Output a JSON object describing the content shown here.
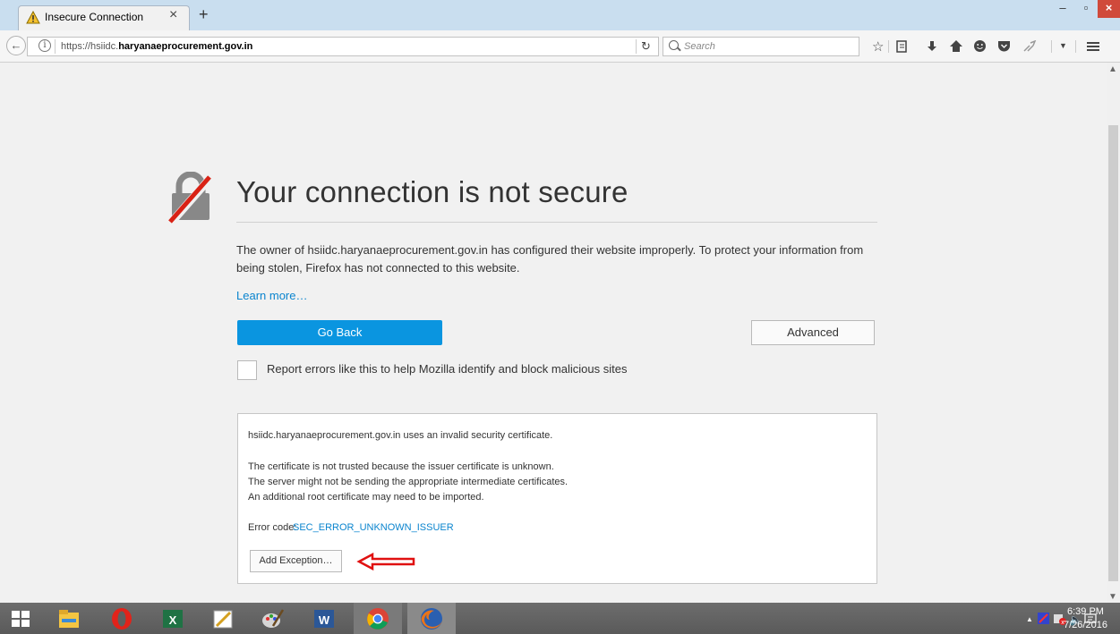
{
  "browser": {
    "tab_title": "Insecure Connection",
    "tab_close": "×",
    "new_tab": "+",
    "window_controls": {
      "minimize": "–",
      "maximize": "▫",
      "close": "×"
    },
    "url_prefix": "https://hsiidc.",
    "url_domain": "haryanaeprocurement.gov.in",
    "search_placeholder": "Search",
    "toolbar_icons": [
      "star-icon",
      "reading-list-icon",
      "download-icon",
      "home-icon",
      "hello-icon",
      "pocket-icon",
      "addon-icon",
      "menu-icon"
    ]
  },
  "page": {
    "heading": "Your connection is not secure",
    "description": "The owner of hsiidc.haryanaeprocurement.gov.in has configured their website improperly. To protect your information from being stolen, Firefox has not connected to this website.",
    "learn_more": "Learn more…",
    "go_back": "Go Back",
    "advanced": "Advanced",
    "report_label": "Report errors like this to help Mozilla identify and block malicious sites",
    "details": {
      "line1": "hsiidc.haryanaeprocurement.gov.in uses an invalid security certificate.",
      "line2": "The certificate is not trusted because the issuer certificate is unknown.",
      "line3": "The server might not be sending the appropriate intermediate certificates.",
      "line4": "An additional root certificate may need to be imported.",
      "error_code_label": "Error code:",
      "error_code": "SEC_ERROR_UNKNOWN_ISSUER",
      "add_exception": "Add Exception…"
    }
  },
  "taskbar": {
    "apps": [
      "windows-start-icon",
      "file-explorer-icon",
      "opera-icon",
      "excel-icon",
      "paint-icon",
      "paint-brush-icon",
      "word-icon",
      "chrome-icon",
      "firefox-icon"
    ],
    "clock_time": "6:39 PM",
    "clock_date": "7/26/2016"
  },
  "colors": {
    "accent": "#0a95e0",
    "link": "#0a84ce",
    "annotation_arrow": "#e01010"
  }
}
